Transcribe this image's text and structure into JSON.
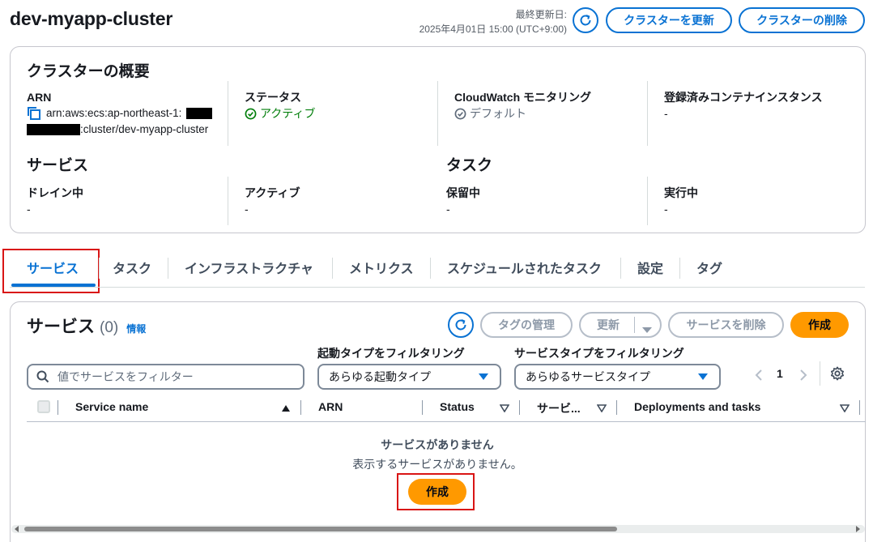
{
  "header": {
    "title": "dev-myapp-cluster",
    "last_updated_label": "最終更新日:",
    "last_updated_value": "2025年4月01日 15:00 (UTC+9:00)",
    "update_cluster_label": "クラスターを更新",
    "delete_cluster_label": "クラスターの削除"
  },
  "overview": {
    "title": "クラスターの概要",
    "arn_label": "ARN",
    "arn_line1": "arn:aws:ecs:ap-northeast-1:",
    "arn_line2": ":cluster/dev-myapp-cluster",
    "status_label": "ステータス",
    "status_value": "アクティブ",
    "cloudwatch_label": "CloudWatch モニタリング",
    "cloudwatch_value": "デフォルト",
    "instances_label": "登録済みコンテナインスタンス",
    "instances_value": "-",
    "services_title": "サービス",
    "draining_label": "ドレイン中",
    "draining_value": "-",
    "active_label": "アクティブ",
    "active_value": "-",
    "tasks_title": "タスク",
    "pending_label": "保留中",
    "pending_value": "-",
    "running_label": "実行中",
    "running_value": "-"
  },
  "tabs": [
    "サービス",
    "タスク",
    "インフラストラクチャ",
    "メトリクス",
    "スケジュールされたタスク",
    "設定",
    "タグ"
  ],
  "services": {
    "title": "サービス",
    "count": "(0)",
    "info_link": "情報",
    "manage_tags_label": "タグの管理",
    "update_label": "更新",
    "delete_label": "サービスを削除",
    "create_label": "作成",
    "search_placeholder": "値でサービスをフィルター",
    "launch_filter_label": "起動タイプをフィルタリング",
    "launch_filter_value": "あらゆる起動タイプ",
    "service_type_filter_label": "サービスタイプをフィルタリング",
    "service_type_filter_value": "あらゆるサービスタイプ",
    "page_number": "1",
    "columns": [
      "Service name",
      "ARN",
      "Status",
      "サービ...",
      "Deployments and tasks"
    ],
    "empty_title": "サービスがありません",
    "empty_desc": "表示するサービスがありません。",
    "empty_create_label": "作成"
  },
  "colors": {
    "accent": "#0972d3",
    "primary_button": "#ff9900",
    "status_active": "#037f0c",
    "highlight_box": "#d91515"
  }
}
